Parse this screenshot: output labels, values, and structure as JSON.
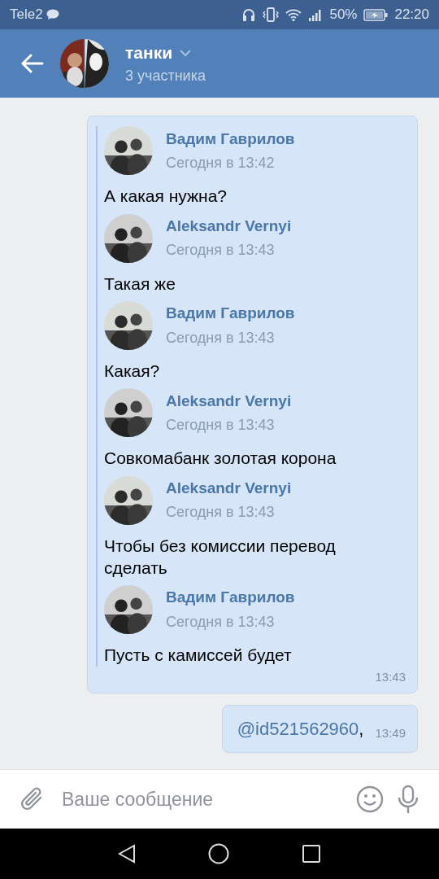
{
  "status_bar": {
    "carrier": "Tele2",
    "battery": "50%",
    "time": "22:20"
  },
  "header": {
    "title": "танки",
    "subtitle": "3 участника"
  },
  "forwarded": {
    "messages": [
      {
        "author": "Вадим Гаврилов",
        "time": "Сегодня в 13:42",
        "text": "А какая нужна?"
      },
      {
        "author": "Aleksandr Vernyi",
        "time": "Сегодня в 13:43",
        "text": "Такая же"
      },
      {
        "author": "Вадим Гаврилов",
        "time": "Сегодня в 13:43",
        "text": "Какая?"
      },
      {
        "author": "Aleksandr Vernyi",
        "time": "Сегодня в 13:43",
        "text": "Совкомабанк золотая корона"
      },
      {
        "author": "Aleksandr Vernyi",
        "time": "Сегодня в 13:43",
        "text": "Чтобы без комиссии перевод сделать"
      },
      {
        "author": "Вадим Гаврилов",
        "time": "Сегодня в 13:43",
        "text": "Пусть с камиссей будет"
      }
    ],
    "time": "13:43"
  },
  "own_message": {
    "mention": "@id521562960",
    "text": ",",
    "time": "13:49"
  },
  "composer": {
    "placeholder": "Ваше сообщение"
  }
}
